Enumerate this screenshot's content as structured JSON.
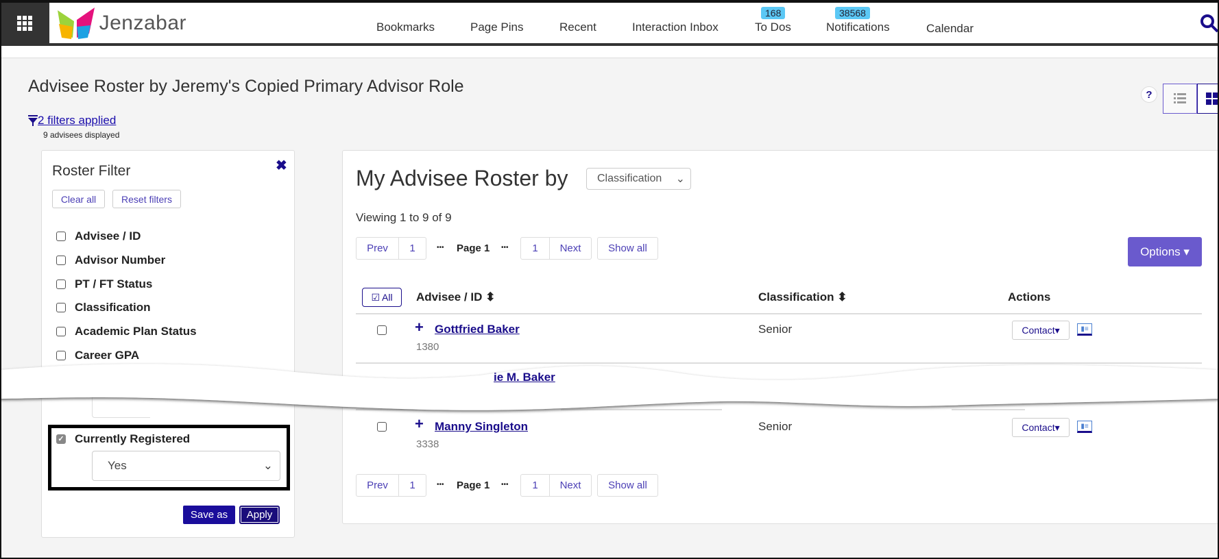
{
  "header": {
    "brand": "Jenzabar",
    "nav": [
      {
        "label": "Bookmarks"
      },
      {
        "label": "Page Pins"
      },
      {
        "label": "Recent"
      },
      {
        "label": "Interaction Inbox"
      },
      {
        "label": "To Dos",
        "badge": "168"
      },
      {
        "label": "Notifications",
        "badge": "38568"
      },
      {
        "label": "Calendar"
      }
    ]
  },
  "page": {
    "title": "Advisee Roster by Jeremy's Copied Primary Advisor Role",
    "filters_link": "2 filters applied",
    "advisees_count": "9 advisees displayed",
    "help": "?"
  },
  "filter": {
    "title": "Roster Filter",
    "clear_all": "Clear all",
    "reset": "Reset filters",
    "items": [
      {
        "label": "Advisee / ID",
        "checked": false
      },
      {
        "label": "Advisor Number",
        "checked": false
      },
      {
        "label": "PT / FT Status",
        "checked": false
      },
      {
        "label": "Classification",
        "checked": false
      },
      {
        "label": "Academic Plan Status",
        "checked": false
      },
      {
        "label": "Career GPA",
        "checked": false
      }
    ],
    "registered": {
      "label": "Currently Registered",
      "checked": true,
      "value": "Yes"
    },
    "save_as": "Save as",
    "apply": "Apply"
  },
  "roster": {
    "heading": "My Advisee Roster by",
    "group_by": "Classification",
    "viewing": "Viewing 1 to 9 of 9",
    "pager": {
      "prev": "Prev",
      "first": "1",
      "current": "Page 1",
      "last": "1",
      "next": "Next",
      "show_all": "Show all",
      "dots": "•••"
    },
    "options": "Options ▾",
    "all": "All",
    "columns": [
      "Advisee / ID",
      "Classification",
      "Actions"
    ],
    "rows": [
      {
        "name": "Gottfried Baker",
        "id": "1380",
        "classification": "Senior",
        "contact": "Contact▾"
      },
      {
        "name_fragment": "ie M. Baker"
      },
      {
        "name": "Manny Singleton",
        "id": "3338",
        "classification": "Senior",
        "contact": "Contact▾"
      }
    ]
  },
  "colors": {
    "accent": "#1a0d8b",
    "options": "#6a5acd",
    "badge": "#5bc8f5"
  }
}
